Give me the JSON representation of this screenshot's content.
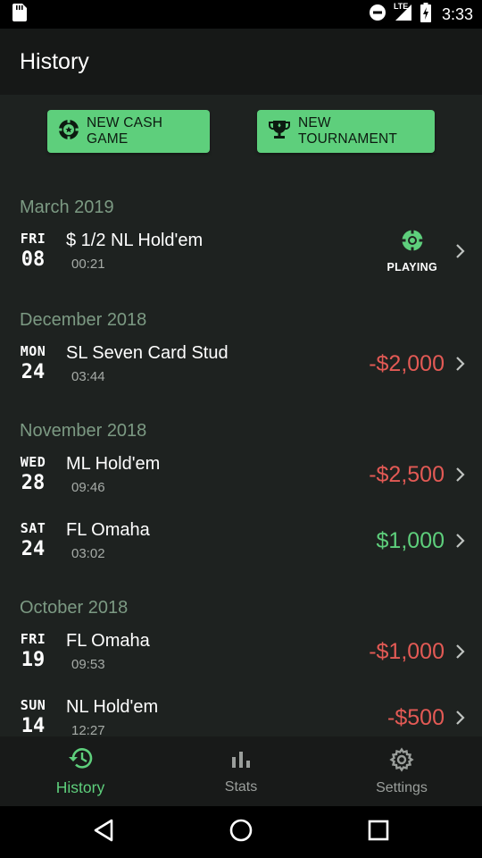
{
  "status_bar": {
    "network": "LTE",
    "time": "3:33"
  },
  "app_bar": {
    "title": "History"
  },
  "actions": {
    "new_cash_game": "NEW CASH GAME",
    "new_tournament": "NEW TOURNAMENT"
  },
  "sections": [
    {
      "header": "March 2019",
      "rows": [
        {
          "dow": "FRI",
          "dom": "08",
          "name": "$ 1/2 NL Hold'em",
          "time": "00:21",
          "status": "PLAYING"
        }
      ]
    },
    {
      "header": "December 2018",
      "rows": [
        {
          "dow": "MON",
          "dom": "24",
          "name": "SL Seven Card Stud",
          "time": "03:44",
          "amount": "-$2,000"
        }
      ]
    },
    {
      "header": "November 2018",
      "rows": [
        {
          "dow": "WED",
          "dom": "28",
          "name": "ML Hold'em",
          "time": "09:46",
          "amount": "-$2,500"
        },
        {
          "dow": "SAT",
          "dom": "24",
          "name": "FL Omaha",
          "time": "03:02",
          "amount": "$1,000"
        }
      ]
    },
    {
      "header": "October 2018",
      "rows": [
        {
          "dow": "FRI",
          "dom": "19",
          "name": "FL Omaha",
          "time": "09:53",
          "amount": "-$1,000"
        },
        {
          "dow": "SUN",
          "dom": "14",
          "name": "NL Hold'em",
          "time": "12:27",
          "amount": "-$500"
        }
      ]
    }
  ],
  "bottom_nav": {
    "history": "History",
    "stats": "Stats",
    "settings": "Settings"
  },
  "colors": {
    "accent": "#5ecf7c",
    "negative": "#e35a55",
    "section_header": "#7c9a83"
  }
}
